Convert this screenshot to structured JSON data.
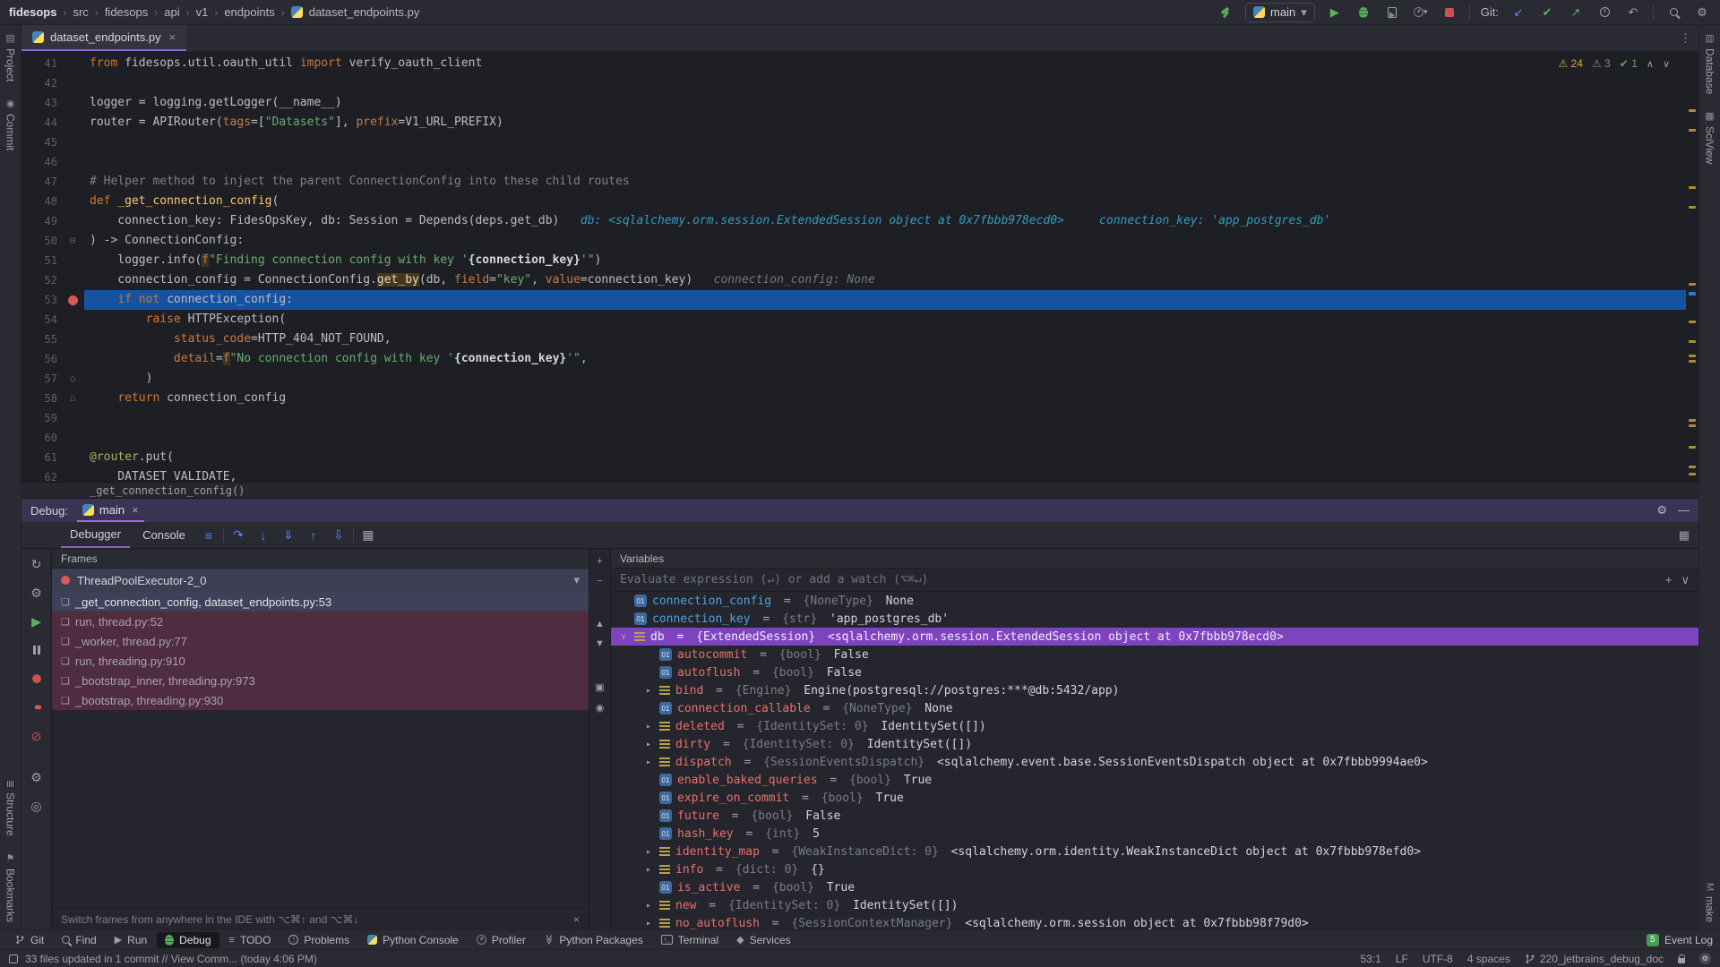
{
  "topbar": {
    "breadcrumbs": [
      "fidesops",
      "src",
      "fidesops",
      "api",
      "v1",
      "endpoints",
      "dataset_endpoints.py"
    ],
    "run_config": "main",
    "git_label": "Git:"
  },
  "tabs": {
    "active_tab": "dataset_endpoints.py"
  },
  "editor": {
    "inspections": {
      "warnings": "24",
      "weak_warnings": "3",
      "ok": "1"
    },
    "sticky_line": "_get_connection_config()",
    "lines": [
      {
        "n": 41,
        "tokens": [
          [
            "k",
            "from"
          ],
          [
            "t",
            " fidesops.util.oauth_util "
          ],
          [
            "k",
            "import"
          ],
          [
            "t",
            " verify_oauth_client"
          ]
        ]
      },
      {
        "n": 42,
        "tokens": []
      },
      {
        "n": 43,
        "tokens": [
          [
            "t",
            "logger = logging.getLogger(__name__)"
          ]
        ]
      },
      {
        "n": 44,
        "tokens": [
          [
            "t",
            "router = APIRouter("
          ],
          [
            "pa",
            "tags"
          ],
          [
            "t",
            "=["
          ],
          [
            "s",
            "\"Datasets\""
          ],
          [
            "t",
            "], "
          ],
          [
            "pa",
            "prefix"
          ],
          [
            "t",
            "=V1_URL_PREFIX)"
          ]
        ]
      },
      {
        "n": 45,
        "tokens": []
      },
      {
        "n": 46,
        "tokens": []
      },
      {
        "n": 47,
        "tokens": [
          [
            "c",
            "# Helper method to inject the parent ConnectionConfig into these child routes"
          ]
        ]
      },
      {
        "n": 48,
        "tokens": [
          [
            "k",
            "def "
          ],
          [
            "fn",
            "_get_connection_config"
          ],
          [
            "t",
            "("
          ]
        ]
      },
      {
        "n": 49,
        "tokens": [
          [
            "t",
            "    connection_key: FidesOpsKey, db: Session = Depends(deps.get_db)"
          ],
          [
            "hintc",
            "   db: <sqlalchemy.orm.session.ExtendedSession object at 0x7fbbb978ecd0>"
          ],
          [
            "hintc",
            "     connection_key: 'app_postgres_db'"
          ]
        ]
      },
      {
        "n": 50,
        "tokens": [
          [
            "t",
            ") -> ConnectionConfig:"
          ]
        ],
        "gutter": "⊟"
      },
      {
        "n": 51,
        "tokens": [
          [
            "t",
            "    logger.info("
          ],
          [
            "fstr",
            "f"
          ],
          [
            "s",
            "\"Finding connection config with key '"
          ],
          [
            "br",
            "{connection_key}"
          ],
          [
            "s",
            "'\""
          ],
          [
            "t",
            ")"
          ]
        ]
      },
      {
        "n": 52,
        "tokens": [
          [
            "t",
            "    connection_config = ConnectionConfig."
          ],
          [
            "hl",
            "get_by"
          ],
          [
            "t",
            "(db, "
          ],
          [
            "pa",
            "field"
          ],
          [
            "t",
            "="
          ],
          [
            "s",
            "\"key\""
          ],
          [
            "t",
            ", "
          ],
          [
            "pa",
            "value"
          ],
          [
            "t",
            "=connection_key)"
          ],
          [
            "hintg",
            "   connection_config: None"
          ]
        ]
      },
      {
        "n": 53,
        "tokens": [
          [
            "t",
            "    "
          ],
          [
            "k",
            "if"
          ],
          [
            "t",
            " "
          ],
          [
            "k",
            "not"
          ],
          [
            "t",
            " connection_config:"
          ]
        ],
        "highlight": true,
        "breakpoint": true
      },
      {
        "n": 54,
        "tokens": [
          [
            "t",
            "        "
          ],
          [
            "k",
            "raise"
          ],
          [
            "t",
            " HTTPException("
          ]
        ]
      },
      {
        "n": 55,
        "tokens": [
          [
            "t",
            "            "
          ],
          [
            "pa",
            "status_code"
          ],
          [
            "t",
            "=HTTP_404_NOT_FOUND,"
          ]
        ]
      },
      {
        "n": 56,
        "tokens": [
          [
            "t",
            "            "
          ],
          [
            "pa",
            "detail"
          ],
          [
            "t",
            "="
          ],
          [
            "fstr",
            "f"
          ],
          [
            "s",
            "\"No connection config with key '"
          ],
          [
            "br",
            "{connection_key}"
          ],
          [
            "s",
            "'\""
          ],
          [
            "t",
            ","
          ]
        ]
      },
      {
        "n": 57,
        "tokens": [
          [
            "t",
            "        )"
          ]
        ],
        "gutter": "⌂"
      },
      {
        "n": 58,
        "tokens": [
          [
            "t",
            "    "
          ],
          [
            "k",
            "return"
          ],
          [
            "t",
            " connection_config"
          ]
        ],
        "gutter": "⌂"
      },
      {
        "n": 59,
        "tokens": []
      },
      {
        "n": 60,
        "tokens": []
      },
      {
        "n": 61,
        "tokens": [
          [
            "d",
            "@router"
          ],
          [
            "t",
            ".put("
          ]
        ]
      },
      {
        "n": 62,
        "tokens": [
          [
            "t",
            "    DATASET_VALIDATE,"
          ]
        ]
      }
    ]
  },
  "debug": {
    "panel_label": "Debug:",
    "session_tab": "main",
    "tab_debugger": "Debugger",
    "tab_console": "Console",
    "frames_header": "Frames",
    "variables_header": "Variables",
    "thread": "ThreadPoolExecutor-2_0",
    "frames": [
      {
        "label": "_get_connection_config, dataset_endpoints.py:53",
        "kind": "selected"
      },
      {
        "label": "run, thread.py:52",
        "kind": "lib"
      },
      {
        "label": "_worker, thread.py:77",
        "kind": "lib"
      },
      {
        "label": "run, threading.py:910",
        "kind": "lib"
      },
      {
        "label": "_bootstrap_inner, threading.py:973",
        "kind": "lib"
      },
      {
        "label": "_bootstrap, threading.py:930",
        "kind": "lib"
      }
    ],
    "frames_hint": "Switch frames from anywhere in the IDE with ⌥⌘↑ and ⌥⌘↓",
    "evaluate_placeholder": "Evaluate expression (↵) or add a watch (⌥⌘↵)",
    "variables": [
      {
        "chev": "",
        "icon": "var",
        "indent": 0,
        "name": "connection_config",
        "nc": "blue",
        "type": "{NoneType}",
        "value": "None"
      },
      {
        "chev": "",
        "icon": "var",
        "indent": 0,
        "name": "connection_key",
        "nc": "blue",
        "type": "{str}",
        "value": "'app_postgres_db'"
      },
      {
        "chev": "open",
        "icon": "list",
        "indent": 0,
        "name": "db",
        "nc": "blue",
        "type": "{ExtendedSession}",
        "value": "<sqlalchemy.orm.session.ExtendedSession object at 0x7fbbb978ecd0>",
        "selected": true
      },
      {
        "chev": "",
        "icon": "var",
        "indent": 1,
        "name": "autocommit",
        "nc": "pink",
        "type": "{bool}",
        "value": "False"
      },
      {
        "chev": "",
        "icon": "var",
        "indent": 1,
        "name": "autoflush",
        "nc": "pink",
        "type": "{bool}",
        "value": "False"
      },
      {
        "chev": "closed",
        "icon": "list",
        "indent": 1,
        "name": "bind",
        "nc": "pink",
        "type": "{Engine}",
        "value": "Engine(postgresql://postgres:***@db:5432/app)"
      },
      {
        "chev": "",
        "icon": "var",
        "indent": 1,
        "name": "connection_callable",
        "nc": "pink",
        "type": "{NoneType}",
        "value": "None"
      },
      {
        "chev": "closed",
        "icon": "list",
        "indent": 1,
        "name": "deleted",
        "nc": "pink",
        "type": "{IdentitySet: 0}",
        "value": "IdentitySet([])"
      },
      {
        "chev": "closed",
        "icon": "list",
        "indent": 1,
        "name": "dirty",
        "nc": "pink",
        "type": "{IdentitySet: 0}",
        "value": "IdentitySet([])"
      },
      {
        "chev": "closed",
        "icon": "list",
        "indent": 1,
        "name": "dispatch",
        "nc": "pink",
        "type": "{SessionEventsDispatch}",
        "value": "<sqlalchemy.event.base.SessionEventsDispatch object at 0x7fbbb9994ae0>"
      },
      {
        "chev": "",
        "icon": "var",
        "indent": 1,
        "name": "enable_baked_queries",
        "nc": "pink",
        "type": "{bool}",
        "value": "True"
      },
      {
        "chev": "",
        "icon": "var",
        "indent": 1,
        "name": "expire_on_commit",
        "nc": "pink",
        "type": "{bool}",
        "value": "True"
      },
      {
        "chev": "",
        "icon": "var",
        "indent": 1,
        "name": "future",
        "nc": "pink",
        "type": "{bool}",
        "value": "False"
      },
      {
        "chev": "",
        "icon": "var",
        "indent": 1,
        "name": "hash_key",
        "nc": "pink",
        "type": "{int}",
        "value": "5"
      },
      {
        "chev": "closed",
        "icon": "list",
        "indent": 1,
        "name": "identity_map",
        "nc": "pink",
        "type": "{WeakInstanceDict: 0}",
        "value": "<sqlalchemy.orm.identity.WeakInstanceDict object at 0x7fbbb978efd0>"
      },
      {
        "chev": "closed",
        "icon": "list",
        "indent": 1,
        "name": "info",
        "nc": "pink",
        "type": "{dict: 0}",
        "value": "{}"
      },
      {
        "chev": "",
        "icon": "var",
        "indent": 1,
        "name": "is_active",
        "nc": "pink",
        "type": "{bool}",
        "value": "True"
      },
      {
        "chev": "closed",
        "icon": "list",
        "indent": 1,
        "name": "new",
        "nc": "pink",
        "type": "{IdentitySet: 0}",
        "value": "IdentitySet([])"
      },
      {
        "chev": "closed",
        "icon": "list",
        "indent": 1,
        "name": "no_autoflush",
        "nc": "pink",
        "type": "{SessionContextManager}",
        "value": "<sqlalchemy.orm.session object at 0x7fbbb98f79d0>"
      }
    ]
  },
  "bottom_bar": {
    "items": [
      {
        "label": "Git",
        "icon": "git-branch"
      },
      {
        "label": "Find",
        "icon": "search"
      },
      {
        "label": "Run",
        "icon": "run"
      },
      {
        "label": "Debug",
        "icon": "bug",
        "active": true
      },
      {
        "label": "TODO",
        "icon": "todo"
      },
      {
        "label": "Problems",
        "icon": "problems"
      },
      {
        "label": "Python Console",
        "icon": "python"
      },
      {
        "label": "Profiler",
        "icon": "profiler"
      },
      {
        "label": "Python Packages",
        "icon": "packages"
      },
      {
        "label": "Terminal",
        "icon": "terminal"
      },
      {
        "label": "Services",
        "icon": "services"
      }
    ],
    "event_log": "Event Log",
    "event_badge": "5"
  },
  "status_bar": {
    "message": "33 files updated in 1 commit // View Comm... (today 4:06 PM)",
    "caret": "53:1",
    "line_sep": "LF",
    "encoding": "UTF-8",
    "indent": "4 spaces",
    "branch": "220_jetbrains_debug_doc"
  },
  "stripes": {
    "left_top": [
      {
        "label": "Project",
        "glyph": "▤"
      },
      {
        "label": "Commit",
        "glyph": "◉"
      }
    ],
    "left_bottom": [
      {
        "label": "Structure",
        "glyph": "≣"
      },
      {
        "label": "Bookmarks",
        "glyph": "⚑"
      }
    ],
    "right_top": [
      {
        "label": "Database",
        "glyph": "▥"
      },
      {
        "label": "SciView",
        "glyph": "▦"
      }
    ],
    "right_bottom": [
      {
        "label": "make",
        "glyph": "M"
      }
    ]
  },
  "icons": {
    "chevron_sep": "›",
    "close": "×",
    "more_v": "⋮",
    "warning": "⚠",
    "check": "✔",
    "chev_up": "∧",
    "chev_down": "∨",
    "dropdown": "▾",
    "run": "▶",
    "rerun": "↻",
    "gear": "⚙",
    "mute": "⊘",
    "breakpoints": "●●",
    "pin": "◎",
    "hamburger": "≡",
    "step_over": "↷",
    "step_into": "↓",
    "force_step_into": "⇓",
    "step_out": "↑",
    "run_to_cursor": "⇩",
    "calc": "▦",
    "layout": "▦",
    "plus": "+",
    "minus": "−",
    "up": "▲",
    "down": "▼",
    "copy": "▣",
    "eye": "◉",
    "update": "↙",
    "push": "↗",
    "undo": "↶",
    "todo": "≡",
    "services": "◆",
    "packages": "≫",
    "frame": "❏",
    "minimize": "—"
  }
}
